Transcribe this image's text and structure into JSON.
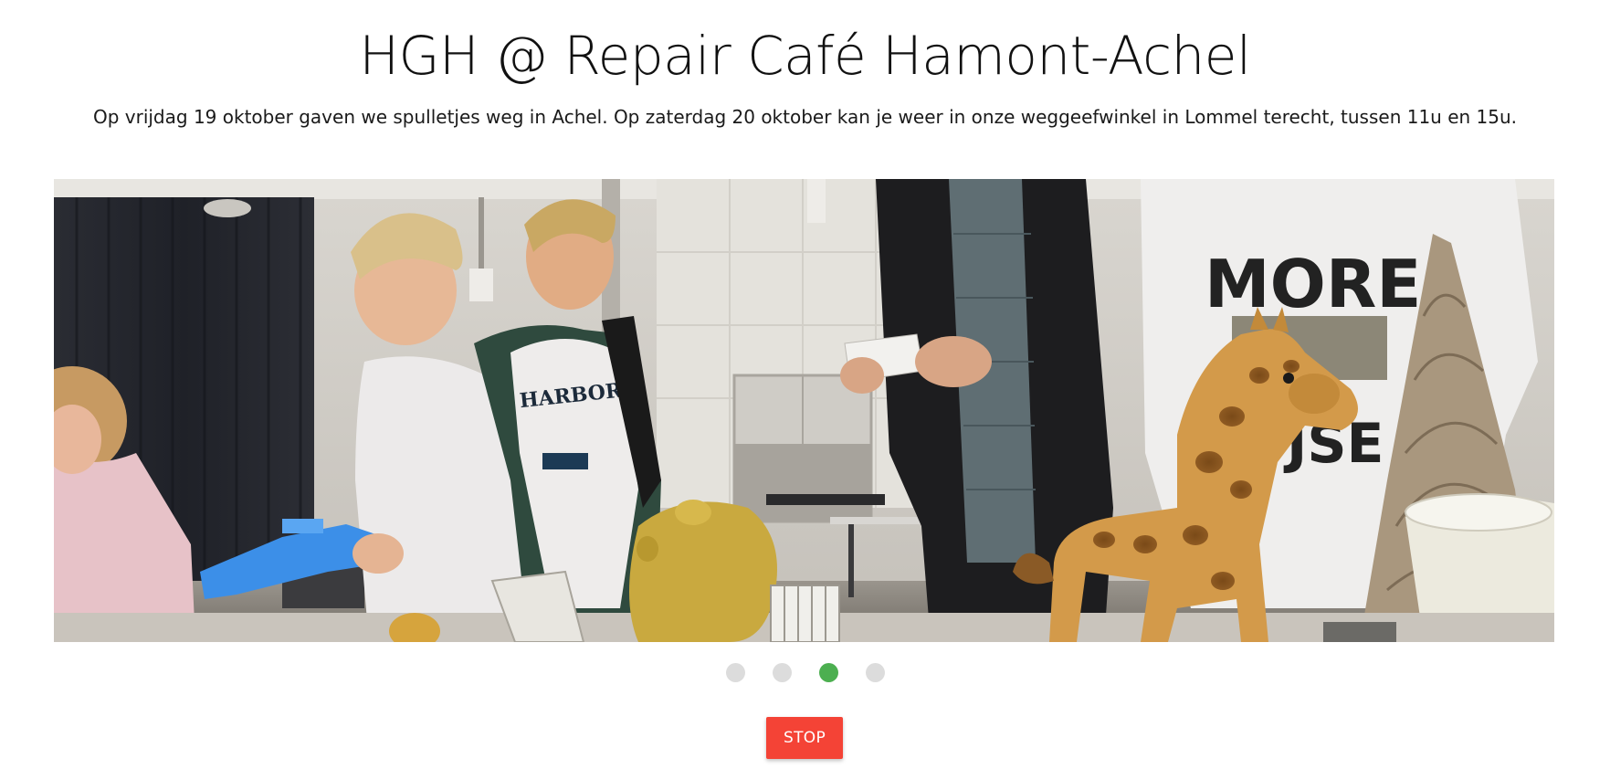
{
  "header": {
    "title": "HGH @ Repair Café Hamont-Achel",
    "subtitle": "Op vrijdag 19 oktober gaven we spulletjes weg in Achel. Op zaterdag 20 oktober kan je weer in onze weggeefwinkel in Lommel terecht, tussen 11u en 15u."
  },
  "slideshow": {
    "slide_count": 4,
    "active_index": 2,
    "photo_description_icon": "photo-children-giraffe-table",
    "dot_color": "#dcdcdc",
    "active_dot_color": "#4caf50"
  },
  "controls": {
    "stop_label": "STOP",
    "stop_color": "#f44336"
  }
}
